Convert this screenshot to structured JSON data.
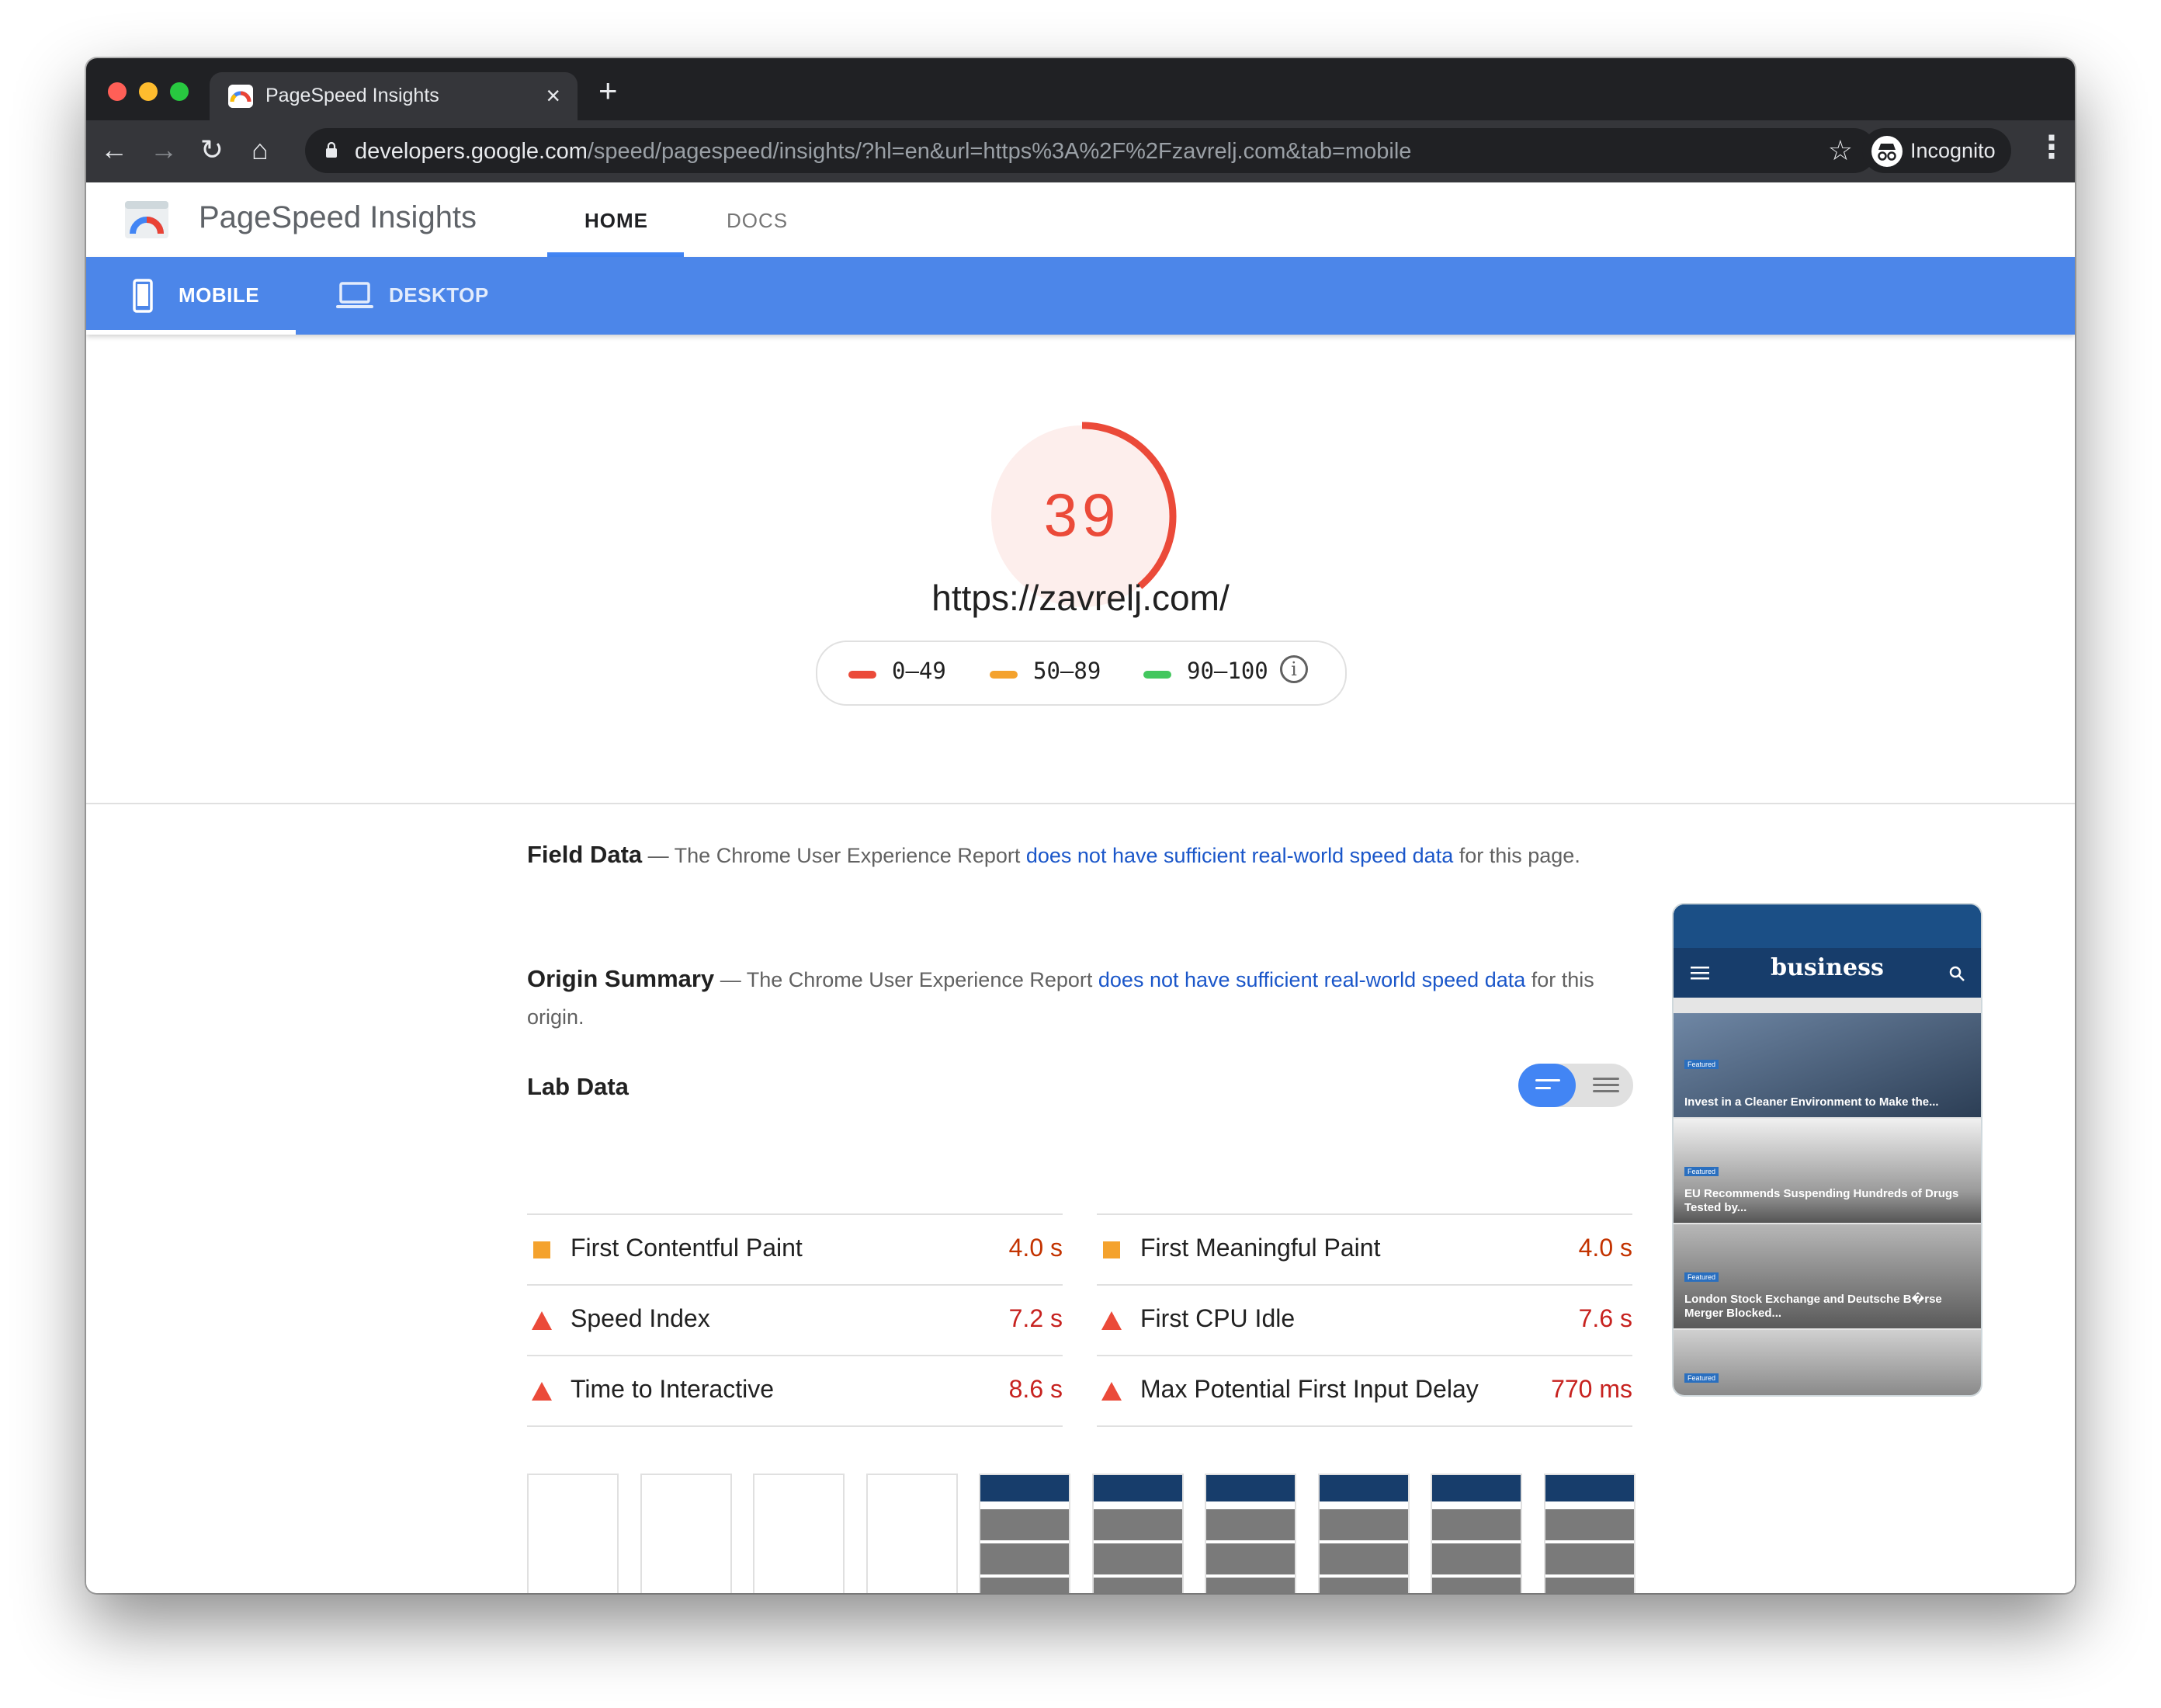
{
  "browser": {
    "tab_title": "PageSpeed Insights",
    "tab_close": "×",
    "new_tab": "+",
    "url_host": "developers.google.com",
    "url_path": "/speed/pagespeed/insights/?hl=en&url=https%3A%2F%2Fzavrelj.com&tab=mobile",
    "profile_label": "Incognito",
    "back": "←",
    "forward": "→",
    "reload": "↻",
    "home": "⌂",
    "star": "☆",
    "menu": "⋮"
  },
  "header": {
    "app_name": "PageSpeed Insights",
    "nav": [
      "HOME",
      "DOCS"
    ]
  },
  "modes": {
    "mobile": "MOBILE",
    "desktop": "DESKTOP"
  },
  "score": {
    "value": "39",
    "fraction": 0.39,
    "color": "#eb4a39",
    "url": "https://zavrelj.com/"
  },
  "legend": {
    "ranges": [
      {
        "label": "0–49",
        "color": "#eb4a39"
      },
      {
        "label": "50–89",
        "color": "#f4a22d"
      },
      {
        "label": "90–100",
        "color": "#43c75e"
      }
    ],
    "info_glyph": "i"
  },
  "field_data": {
    "title": "Field Data",
    "pre": " — The Chrome User Experience Report ",
    "link": "does not have sufficient real-world speed data",
    "post": " for this page."
  },
  "origin_summary": {
    "title": "Origin Summary",
    "pre": " — The Chrome User Experience Report ",
    "link": "does not have sufficient real-world speed data",
    "post": " for this origin."
  },
  "lab_data": {
    "title": "Lab Data",
    "metrics_left": [
      {
        "name": "First Contentful Paint",
        "value": "4.0 s",
        "status": "average"
      },
      {
        "name": "Speed Index",
        "value": "7.2 s",
        "status": "fail"
      },
      {
        "name": "Time to Interactive",
        "value": "8.6 s",
        "status": "fail"
      }
    ],
    "metrics_right": [
      {
        "name": "First Meaningful Paint",
        "value": "4.0 s",
        "status": "average"
      },
      {
        "name": "First CPU Idle",
        "value": "7.6 s",
        "status": "fail"
      },
      {
        "name": "Max Potential First Input Delay",
        "value": "770 ms",
        "status": "fail"
      }
    ]
  },
  "screenshot": {
    "brand": "business",
    "badge": "Featured",
    "cards": [
      "Invest in a Cleaner Environment to Make the...",
      "EU Recommends Suspending Hundreds of Drugs Tested by...",
      "London Stock Exchange and Deutsche B�rse Merger Blocked..."
    ]
  },
  "filmstrip": {
    "frames": [
      "blank",
      "blank",
      "blank",
      "blank",
      "page",
      "page",
      "page",
      "page",
      "page",
      "page"
    ]
  }
}
